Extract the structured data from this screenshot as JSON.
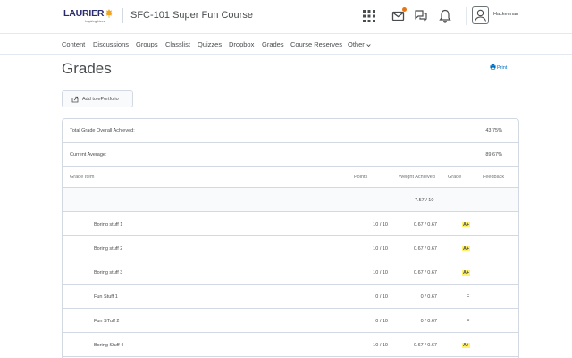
{
  "header": {
    "logo_text": "LAURIER",
    "logo_sub": "Inspiring Lives.",
    "course_title": "SFC-101 Super Fun Course",
    "icons": [
      "apps-grid-icon",
      "mail-icon",
      "chat-icon",
      "bell-icon"
    ],
    "mail_badge_color": "#e87511",
    "username": "Hackerman"
  },
  "nav": {
    "items": [
      "Content",
      "Discussions",
      "Groups",
      "Classlist",
      "Quizzes",
      "Dropbox",
      "Grades",
      "Course Reserves",
      "Other"
    ]
  },
  "page": {
    "title": "Grades",
    "print_label": "Print",
    "eportfolio_label": "Add to ePortfolio"
  },
  "summary": {
    "overall_label": "Total Grade Overall Achieved:",
    "overall_value": "43.75%",
    "current_label": "Current Average:",
    "current_value": "89.67%"
  },
  "table": {
    "headers": {
      "item": "Grade Item",
      "points": "Points",
      "weight": "Weight Achieved",
      "grade": "Grade",
      "feedback": "Feedback"
    },
    "category_weight": "7.57 / 10",
    "rows": [
      {
        "name": "Boring stuff 1",
        "points": "10 / 10",
        "weight": "0.67 / 0.67",
        "grade": "A+",
        "highlight": true
      },
      {
        "name": "Boring stuff 2",
        "points": "10 / 10",
        "weight": "0.67 / 0.67",
        "grade": "A+",
        "highlight": true
      },
      {
        "name": "Boring stuff 3",
        "points": "10 / 10",
        "weight": "0.67 / 0.67",
        "grade": "A+",
        "highlight": true
      },
      {
        "name": "Fun Stuff 1",
        "points": "0 / 10",
        "weight": "0 / 0.67",
        "grade": "F",
        "highlight": false
      },
      {
        "name": "Fun STuff 2",
        "points": "0 / 10",
        "weight": "0 / 0.67",
        "grade": "F",
        "highlight": false
      },
      {
        "name": "Boring Stuff 4",
        "points": "10 / 10",
        "weight": "0.67 / 0.67",
        "grade": "A+",
        "highlight": true
      }
    ]
  }
}
